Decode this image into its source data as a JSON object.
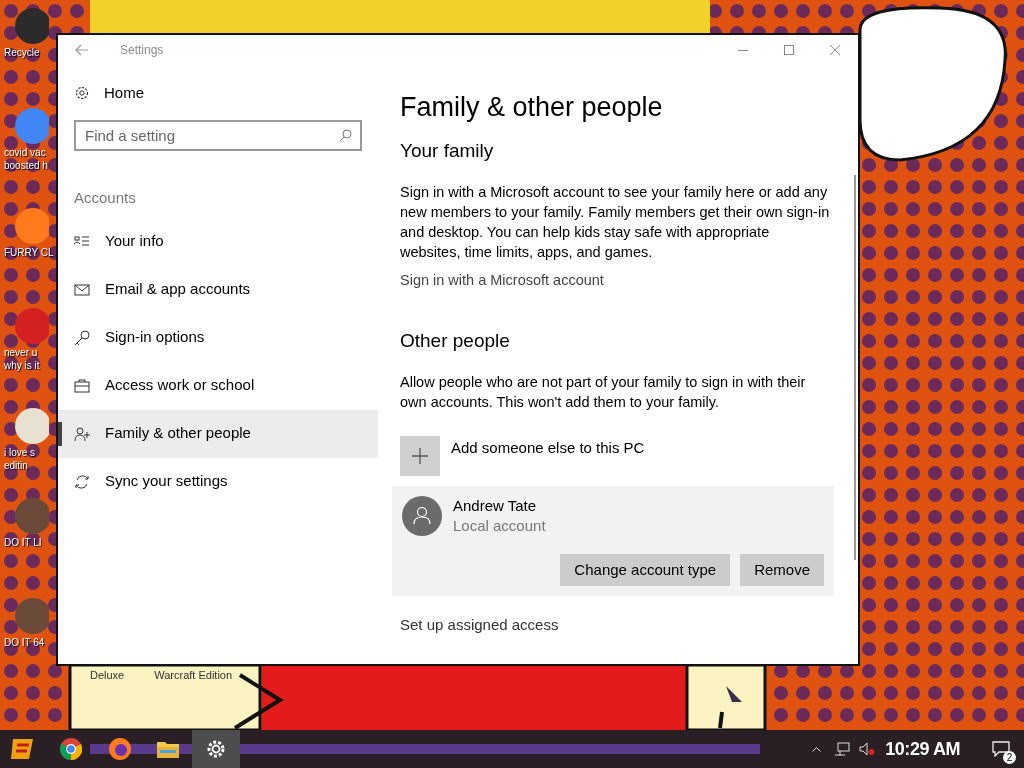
{
  "desktop_icons": [
    {
      "label": "Recycle"
    },
    {
      "label": "covid vac\nboosted h"
    },
    {
      "label": "FURRY CL"
    },
    {
      "label": "never u\nwhy is it"
    },
    {
      "label": "i love s\neditin"
    },
    {
      "label": "DO IT LI"
    },
    {
      "label": "DO IT 64"
    }
  ],
  "bottom_labels": [
    "Deluxe",
    "Warcraft Edition"
  ],
  "window": {
    "title": "Settings"
  },
  "sidebar": {
    "home": "Home",
    "search": {
      "placeholder": "Find a setting"
    },
    "section": "Accounts",
    "items": [
      {
        "label": "Your info",
        "selected": false
      },
      {
        "label": "Email & app accounts",
        "selected": false
      },
      {
        "label": "Sign-in options",
        "selected": false
      },
      {
        "label": "Access work or school",
        "selected": false
      },
      {
        "label": "Family & other people",
        "selected": true
      },
      {
        "label": "Sync your settings",
        "selected": false
      }
    ]
  },
  "content": {
    "title": "Family & other people",
    "sections": [
      {
        "heading": "Your family",
        "text": "Sign in with a Microsoft account to see your family here or add any new members to your family. Family members get their own sign-in and desktop. You can help kids stay safe with appropriate websites, time limits, apps, and games.",
        "link": "Sign in with a Microsoft account"
      },
      {
        "heading": "Other people",
        "text": "Allow people who are not part of your family to sign in with their own accounts. This won't add them to your family."
      }
    ],
    "add_button": "Add someone else to this PC",
    "account": {
      "name": "Andrew Tate",
      "type": "Local account",
      "buttons": [
        "Change account type",
        "Remove"
      ]
    },
    "footer_link": "Set up assigned access"
  },
  "taskbar": {
    "time": "10:29 AM",
    "notification_count": "2"
  }
}
